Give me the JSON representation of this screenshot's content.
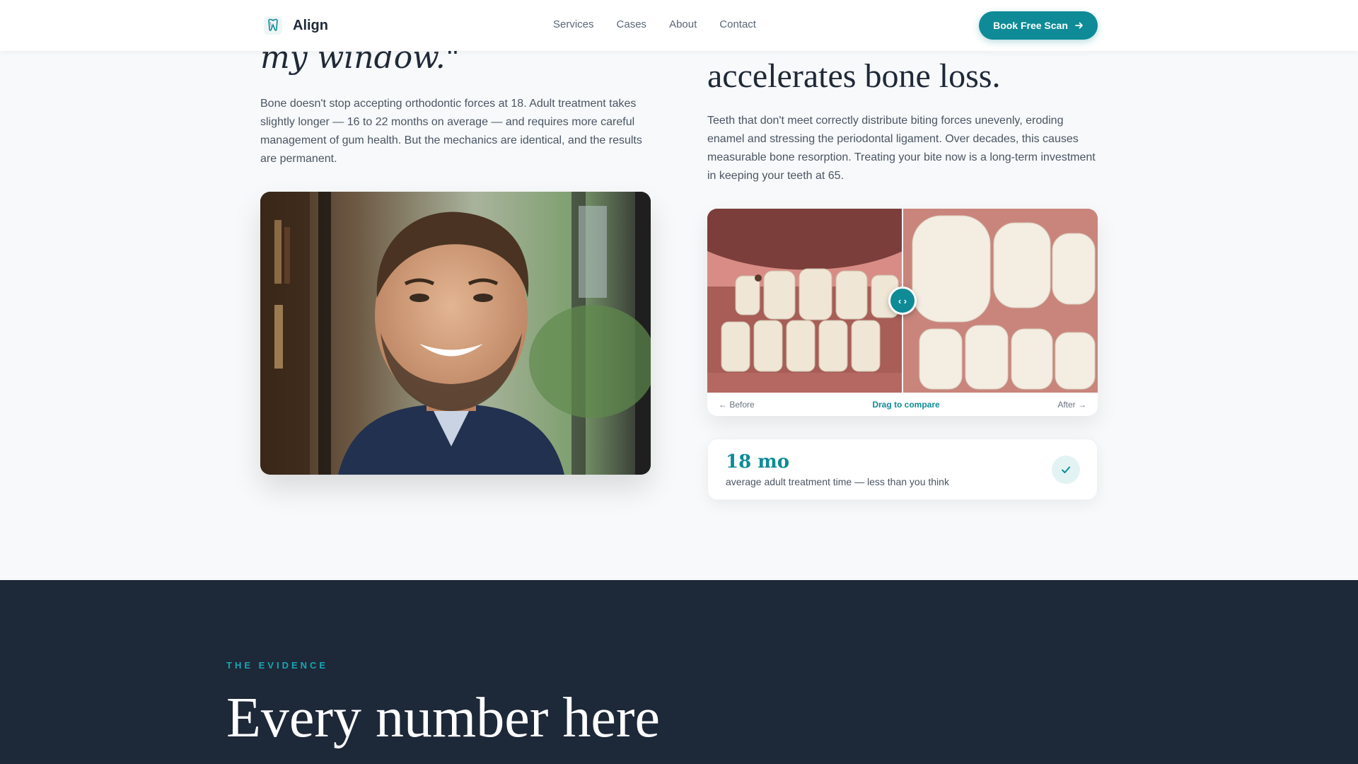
{
  "header": {
    "brand": "Align",
    "nav": [
      "Services",
      "Cases",
      "About",
      "Contact"
    ],
    "cta_label": "Book Free Scan"
  },
  "left": {
    "quote_tail": "my window.\"",
    "body": "Bone doesn't stop accepting orthodontic forces at 18. Adult treatment takes slightly longer — 16 to 22 months on average — and requires more careful management of gum health. But the mechanics are identical, and the results are permanent."
  },
  "right": {
    "heading_tail": "accelerates bone loss.",
    "body": "Teeth that don't meet correctly distribute biting forces unevenly, eroding enamel and stressing the periodontal ligament. Over decades, this causes measurable bone resorption. Treating your bite now is a long-term investment in keeping your teeth at 65.",
    "compare": {
      "before_label": "← Before",
      "drag_label": "Drag to compare",
      "after_label": "After →",
      "slider_position": 0.5
    },
    "stat": {
      "value": "18 mo",
      "description": "average adult treatment time — less than you think"
    }
  },
  "evidence": {
    "eyebrow": "THE EVIDENCE",
    "title": "Every number here"
  },
  "colors": {
    "accent": "#0e8b96",
    "dark_bg": "#1d2838",
    "page_bg": "#f7f9fa"
  }
}
